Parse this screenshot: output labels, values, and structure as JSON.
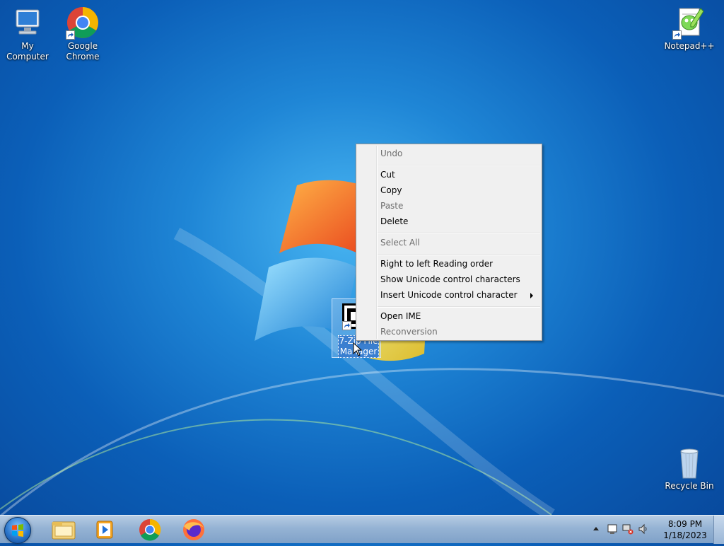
{
  "desktop": {
    "icons": [
      {
        "label_line1": "My Computer",
        "label_line2": ""
      },
      {
        "label_line1": "Google",
        "label_line2": "Chrome"
      },
      {
        "label_line1": "Notepad++",
        "label_line2": ""
      },
      {
        "label_line1": "Recycle Bin",
        "label_line2": ""
      }
    ],
    "selected_icon": {
      "label_line1": "7-Zip File",
      "label_line2": "Manager"
    }
  },
  "context_menu": {
    "items": [
      {
        "label": "Undo",
        "enabled": false
      },
      {
        "label": "Cut",
        "enabled": true
      },
      {
        "label": "Copy",
        "enabled": true
      },
      {
        "label": "Paste",
        "enabled": false
      },
      {
        "label": "Delete",
        "enabled": true
      },
      {
        "label": "Select All",
        "enabled": false
      },
      {
        "label": "Right to left Reading order",
        "enabled": true
      },
      {
        "label": "Show Unicode control characters",
        "enabled": true
      },
      {
        "label": "Insert Unicode control character",
        "enabled": true,
        "submenu": true
      },
      {
        "label": "Open IME",
        "enabled": true
      },
      {
        "label": "Reconversion",
        "enabled": false
      }
    ]
  },
  "taskbar": {
    "pinned": [
      "windows-explorer-icon",
      "media-player-icon",
      "chrome-icon",
      "firefox-icon"
    ],
    "clock": {
      "time": "8:09 PM",
      "date": "1/18/2023"
    }
  },
  "colors": {
    "desktop_accent": "#1f86d6",
    "menu_bg": "#f0f0f0",
    "taskbar": "#95b3d4"
  }
}
